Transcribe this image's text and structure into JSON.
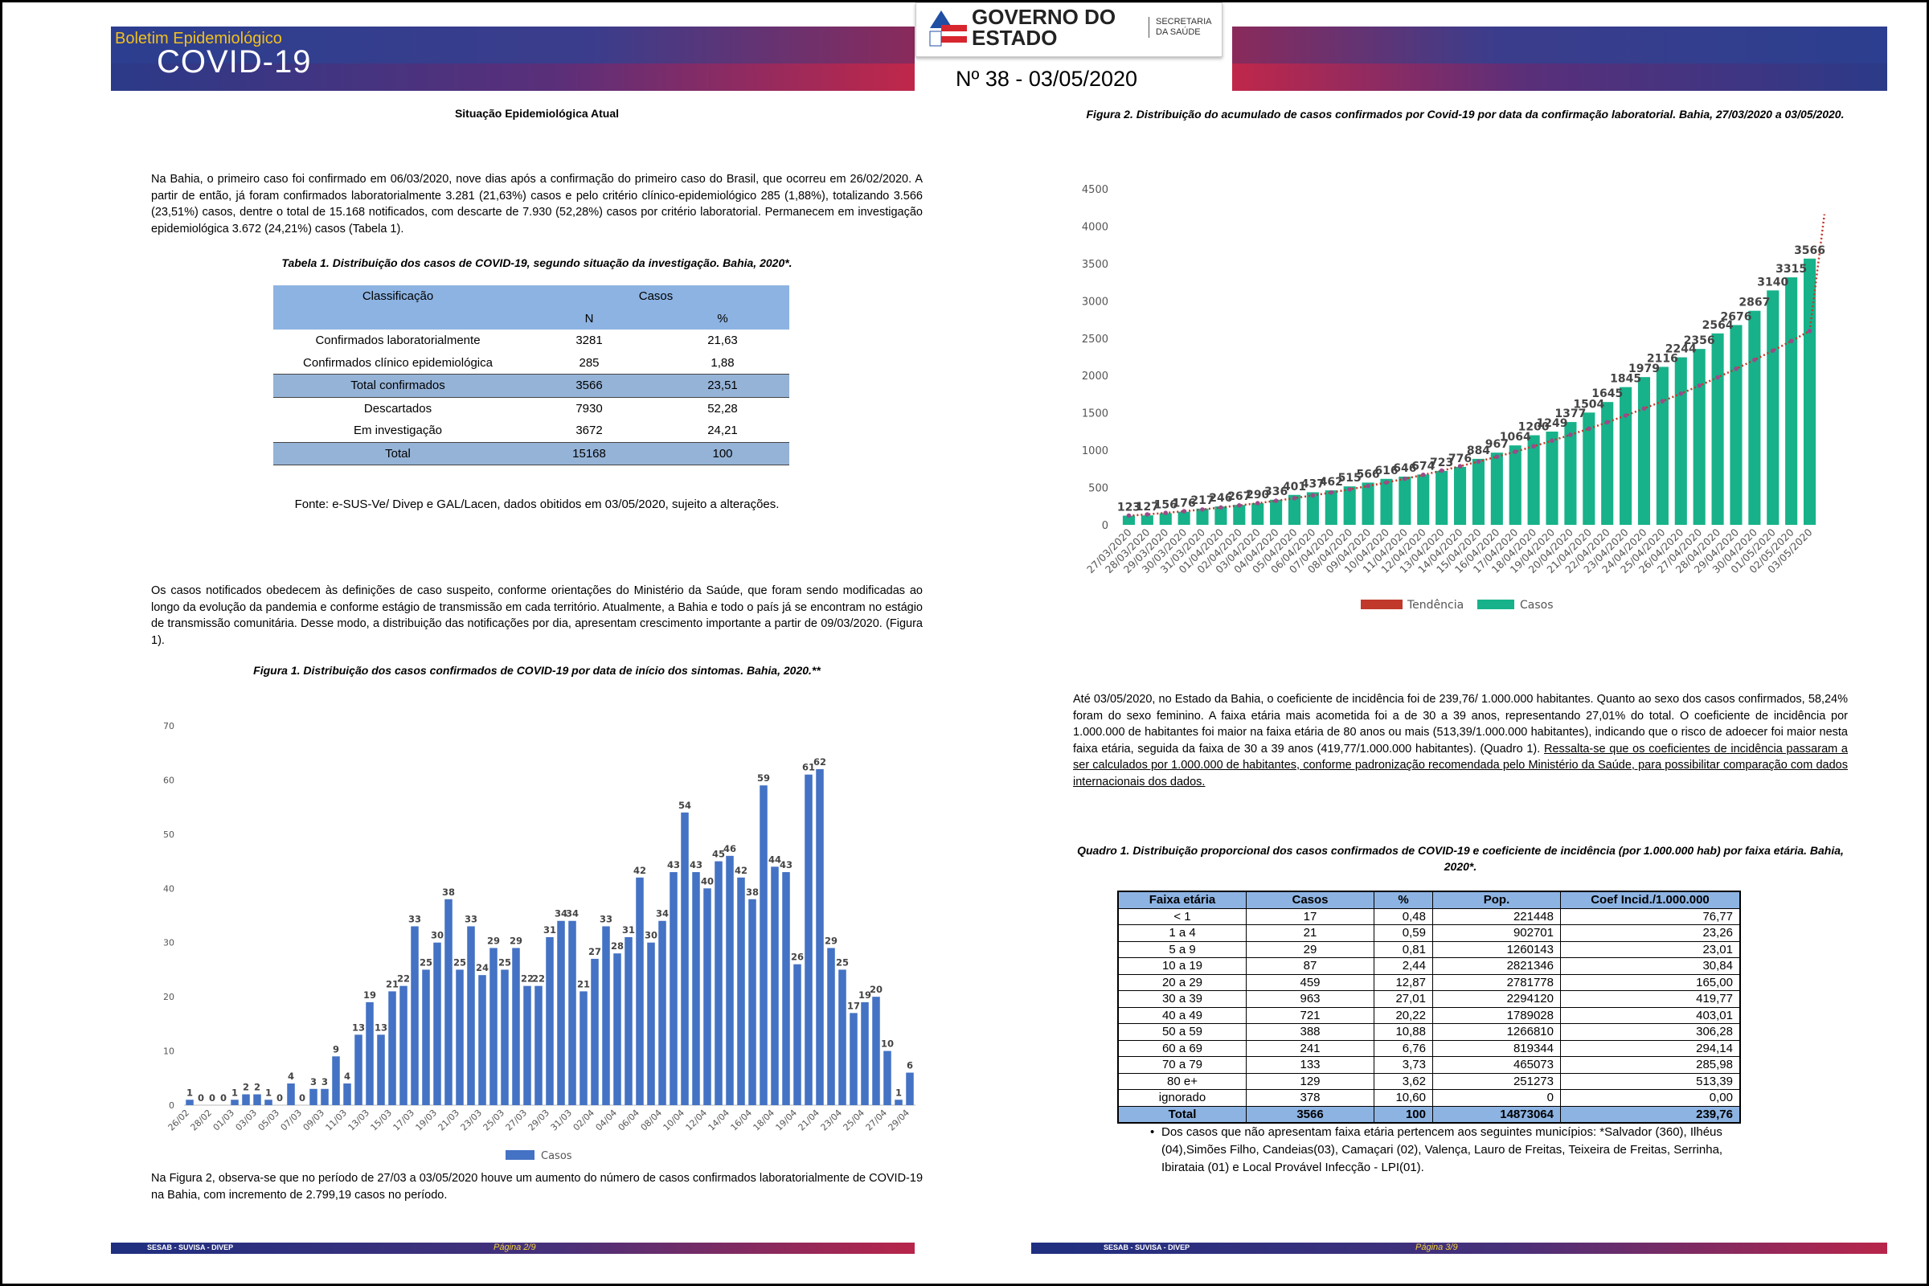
{
  "header": {
    "boletim": "Boletim Epidemiológico",
    "covid": "COVID-19",
    "governo": "GOVERNO DO ESTADO",
    "secretaria": "SECRETARIA DA SAÚDE",
    "numero": "Nº 38 - 03/05/2020"
  },
  "left": {
    "section_title": "Situação Epidemiológica Atual",
    "para1": "Na Bahia, o primeiro caso foi confirmado em 06/03/2020, nove dias após a confirmação do primeiro caso do Brasil, que ocorreu em 26/02/2020. A partir de então, já foram confirmados laboratorialmente 3.281 (21,63%) casos e pelo critério clínico-epidemiológico 285 (1,88%), totalizando 3.566 (23,51%) casos, dentre o total de 15.168 notificados, com descarte de 7.930 (52,28%) casos por critério laboratorial. Permanecem em investigação epidemiológica 3.672 (24,21%) casos (Tabela 1).",
    "table1_caption": "Tabela 1. Distribuição dos casos de COVID-19, segundo situação da investigação. Bahia, 2020*.",
    "table1": {
      "h_class": "Classificação",
      "h_casos": "Casos",
      "h_n": "N",
      "h_pct": "%",
      "rows": [
        {
          "c": "Confirmados laboratorialmente",
          "n": "3281",
          "p": "21,63"
        },
        {
          "c": "Confirmados clínico epidemiológica",
          "n": "285",
          "p": "1,88"
        },
        {
          "c": "Total confirmados",
          "n": "3566",
          "p": "23,51"
        },
        {
          "c": "Descartados",
          "n": "7930",
          "p": "52,28"
        },
        {
          "c": "Em investigação",
          "n": "3672",
          "p": "24,21"
        },
        {
          "c": "Total",
          "n": "15168",
          "p": "100"
        }
      ]
    },
    "fonte": "Fonte: e-SUS-Ve/ Divep e GAL/Lacen, dados obitidos em 03/05/2020, sujeito a alterações.",
    "para2": "Os casos notificados obedecem às definições de caso suspeito, conforme orientações do Ministério da Saúde, que foram sendo modificadas ao longo da evolução da pandemia e conforme estágio de transmissão em cada território. Atualmente, a Bahia e todo o país já se encontram no estágio de transmissão comunitária. Desse modo, a distribuição das notificações por dia, apresentam crescimento importante a partir de 09/03/2020. (Figura 1).",
    "fig1_caption": "Figura 1. Distribuição dos casos confirmados de COVID-19 por data de início dos sintomas. Bahia, 2020.**",
    "para3": "Na Figura 2, observa-se que no período de 27/03 a 03/05/2020 houve um aumento do número de casos confirmados laboratorialmente de COVID-19 na Bahia, com incremento de 2.799,19 casos no período.",
    "footer_org": "SESAB - SUVISA - DIVEP",
    "footer_page": "Página 2/9"
  },
  "right": {
    "fig2_caption": "Figura 2. Distribuição do acumulado de casos confirmados por Covid-19 por data da confirmação laboratorial. Bahia, 27/03/2020 a 03/05/2020.",
    "para1": "Até 03/05/2020, no Estado da Bahia, o coeficiente de incidência foi de 239,76/ 1.000.000 habitantes. Quanto ao sexo dos casos confirmados, 58,24% foram do sexo feminino. A faixa etária mais acometida foi a de 30 a 39 anos, representando 27,01% do total. O coeficiente de incidência por 1.000.000 de habitantes foi maior na faixa etária de 80 anos ou mais (513,39/1.000.000 habitantes), indicando que o risco de adoecer foi maior nesta faixa etária, seguida da faixa de 30 a 39 anos (419,77/1.000.000 habitantes). (Quadro 1).",
    "para1_underlined": "Ressalta-se que os coeficientes de incidência passaram a ser calculados por 1.000.000 de habitantes, conforme padronização recomendada pelo Ministério da Saúde, para possibilitar comparação com dados internacionais dos dados.",
    "quadro_caption": "Quadro 1. Distribuição proporcional dos casos confirmados de COVID-19 e coeficiente de incidência (por 1.000.000 hab) por faixa etária. Bahia, 2020*.",
    "quadro": {
      "headers": [
        "Faixa etária",
        "Casos",
        "%",
        "Pop.",
        "Coef Incid./1.000.000"
      ],
      "rows": [
        [
          "< 1",
          "17",
          "0,48",
          "221448",
          "76,77"
        ],
        [
          "1 a 4",
          "21",
          "0,59",
          "902701",
          "23,26"
        ],
        [
          "5 a 9",
          "29",
          "0,81",
          "1260143",
          "23,01"
        ],
        [
          "10 a 19",
          "87",
          "2,44",
          "2821346",
          "30,84"
        ],
        [
          "20 a 29",
          "459",
          "12,87",
          "2781778",
          "165,00"
        ],
        [
          "30 a 39",
          "963",
          "27,01",
          "2294120",
          "419,77"
        ],
        [
          "40 a 49",
          "721",
          "20,22",
          "1789028",
          "403,01"
        ],
        [
          "50 a 59",
          "388",
          "10,88",
          "1266810",
          "306,28"
        ],
        [
          "60 a 69",
          "241",
          "6,76",
          "819344",
          "294,14"
        ],
        [
          "70 a 79",
          "133",
          "3,73",
          "465073",
          "285,98"
        ],
        [
          "80 e+",
          "129",
          "3,62",
          "251273",
          "513,39"
        ],
        [
          "ignorado",
          "378",
          "10,60",
          "0",
          "0,00"
        ]
      ],
      "total": [
        "Total",
        "3566",
        "100",
        "14873064",
        "239,76"
      ]
    },
    "bullet": "Dos casos que não apresentam faixa etária pertencem aos seguintes municípios: *Salvador (360), Ilhéus (04),Simões Filho, Candeias(03), Camaçari (02), Valença, Lauro de Freitas, Teixeira de Freitas, Serrinha, Ibirataia (01) e Local Provável Infecção - LPI(01).",
    "footer_org": "SESAB - SUVISA - DIVEP",
    "footer_page": "Página 3/9"
  },
  "chart_data": [
    {
      "type": "bar",
      "title": "",
      "xlabel": "",
      "ylabel": "",
      "ylim": [
        0,
        70
      ],
      "yticks": [
        0,
        10,
        20,
        30,
        40,
        50,
        60,
        70
      ],
      "legend": "bottom",
      "grid": false,
      "color": "#4472c4",
      "tick_labels": [
        "26/02",
        "28/02",
        "01/03",
        "03/03",
        "05/03",
        "07/03",
        "09/03",
        "11/03",
        "13/03",
        "15/03",
        "17/03",
        "19/03",
        "21/03",
        "23/03",
        "25/03",
        "27/03",
        "29/03",
        "31/03",
        "02/04",
        "04/04",
        "06/04",
        "08/04",
        "10/04",
        "12/04",
        "14/04",
        "16/04",
        "18/04",
        "19/04",
        "21/04",
        "23/04",
        "25/04",
        "27/04",
        "29/04"
      ],
      "series": [
        {
          "name": "Casos",
          "values": [
            1,
            0,
            0,
            0,
            1,
            2,
            2,
            1,
            0,
            4,
            0,
            3,
            3,
            9,
            4,
            13,
            19,
            13,
            21,
            22,
            33,
            25,
            30,
            38,
            25,
            33,
            24,
            29,
            25,
            29,
            22,
            22,
            31,
            34,
            34,
            21,
            27,
            33,
            28,
            31,
            42,
            30,
            34,
            43,
            54,
            43,
            40,
            45,
            46,
            42,
            38,
            59,
            44,
            43,
            26,
            61,
            62,
            29,
            25,
            17,
            19,
            20,
            10,
            1,
            6
          ]
        }
      ]
    },
    {
      "type": "bar",
      "title": "",
      "xlabel": "",
      "ylabel": "",
      "ylim": [
        0,
        4500
      ],
      "yticks": [
        0,
        500,
        1000,
        1500,
        2000,
        2500,
        3000,
        3500,
        4000,
        4500
      ],
      "legend": "bottom",
      "grid": false,
      "color": "#17b28a",
      "trend_color": "#c0392b",
      "categories": [
        "27/03/2020",
        "28/03/2020",
        "29/03/2020",
        "30/03/2020",
        "31/03/2020",
        "01/04/2020",
        "02/04/2020",
        "03/04/2020",
        "04/04/2020",
        "05/04/2020",
        "06/04/2020",
        "07/04/2020",
        "08/04/2020",
        "09/04/2020",
        "10/04/2020",
        "11/04/2020",
        "12/04/2020",
        "13/04/2020",
        "14/04/2020",
        "15/04/2020",
        "16/04/2020",
        "17/04/2020",
        "18/04/2020",
        "19/04/2020",
        "20/04/2020",
        "21/04/2020",
        "22/04/2020",
        "23/04/2020",
        "24/04/2020",
        "25/04/2020",
        "26/04/2020",
        "27/04/2020",
        "28/04/2020",
        "29/04/2020",
        "30/04/2020",
        "01/05/2020",
        "02/05/2020",
        "03/05/2020"
      ],
      "series": [
        {
          "name": "Casos",
          "values": [
            123,
            127,
            156,
            176,
            217,
            246,
            267,
            290,
            336,
            401,
            437,
            462,
            515,
            566,
            616,
            646,
            674,
            723,
            776,
            884,
            967,
            1064,
            1200,
            1249,
            1377,
            1504,
            1645,
            1845,
            1979,
            2116,
            2244,
            2356,
            2564,
            2676,
            2867,
            3140,
            3315,
            3566
          ]
        },
        {
          "name": "Tendência",
          "values": [
            123,
            140,
            160,
            182,
            206,
            232,
            260,
            290,
            322,
            357,
            394,
            433,
            475,
            520,
            567,
            617,
            670,
            726,
            785,
            847,
            912,
            980,
            1052,
            1127,
            1206,
            1288,
            1374,
            1464,
            1558,
            1656,
            1758,
            1864,
            1975,
            2090,
            2210,
            2334,
            2463,
            2597
          ]
        }
      ],
      "trend_end_value": 4160
    }
  ]
}
